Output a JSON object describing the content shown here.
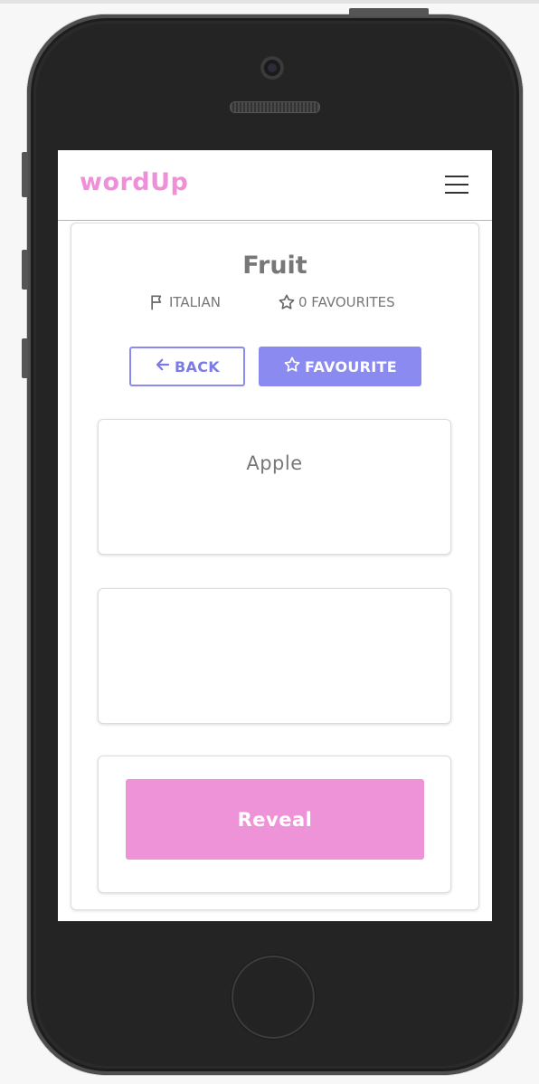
{
  "app": {
    "brand": "wordUp",
    "colors": {
      "brand_pink": "#ee8fd8",
      "primary_purple": "#8a8af0",
      "text_gray": "#777777"
    }
  },
  "deck": {
    "title": "Fruit",
    "language": "ITALIAN",
    "favourites": "0 FAVOURITES"
  },
  "actions": {
    "back_label": "BACK",
    "favourite_label": "FAVOURITE"
  },
  "flashcard": {
    "front_word": "Apple",
    "back_word": "",
    "reveal_label": "Reveal"
  },
  "icons": {
    "menu": "hamburger-menu-icon",
    "language": "flag-icon",
    "favourites": "star-outline-icon",
    "back": "arrow-left-icon",
    "favourite": "star-outline-icon"
  }
}
